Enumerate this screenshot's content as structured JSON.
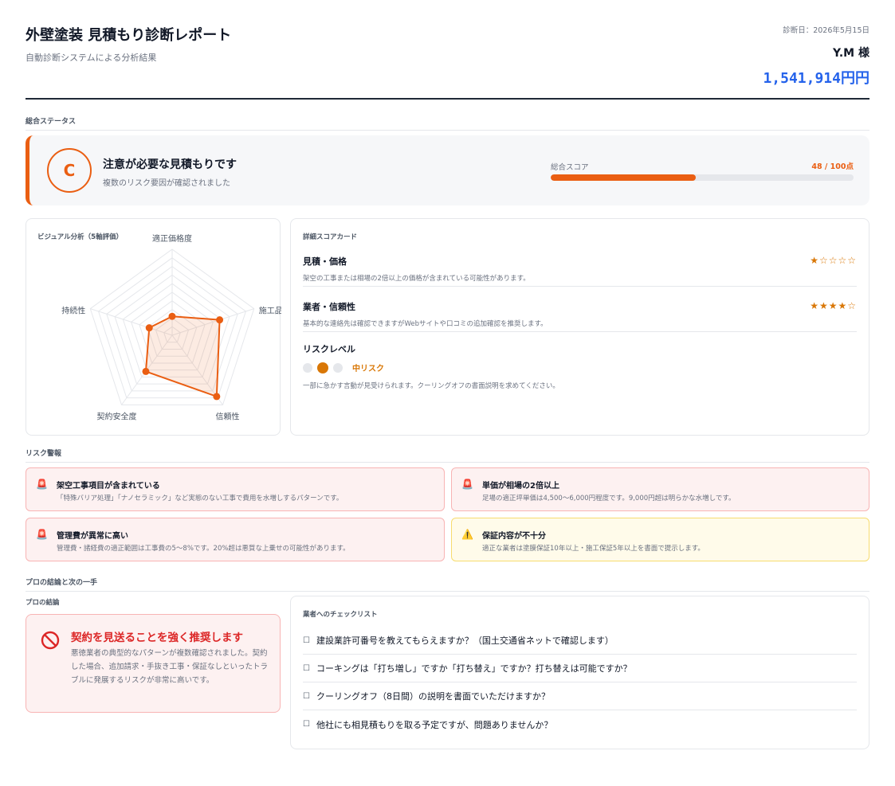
{
  "header": {
    "title": "外壁塗装 見積もり診断レポート",
    "subtitle": "自動診断システムによる分析結果",
    "date": "診断日：2026年5月15日",
    "client": "Y.M 様",
    "amount": "1,541,914円円"
  },
  "sections": {
    "status": "総合ステータス",
    "risks": "リスク警報",
    "conclusion": "プロの結論と次の一手"
  },
  "status": {
    "grade": "C",
    "title": "注意が必要な見積もりです",
    "subtitle": "複数のリスク要因が確認されました",
    "score_label": "総合スコア",
    "score_text": "48 / 100点",
    "score_percent": 48,
    "accent": "#ea5e12"
  },
  "radar": {
    "title": "ビジュアル分析（5軸評価）",
    "axes": [
      {
        "label": "適正価格度",
        "value": 0.22
      },
      {
        "label": "施工品質",
        "value": 0.58
      },
      {
        "label": "信頼性",
        "value": 0.88
      },
      {
        "label": "契約安全度",
        "value": 0.52
      },
      {
        "label": "持続性",
        "value": 0.28
      }
    ],
    "levels": 10,
    "stroke": "#ea5e12"
  },
  "score_card": {
    "title": "詳細スコアカード",
    "rows": [
      {
        "name": "見積・価格",
        "stars": "★☆☆☆☆",
        "desc": "架空の工事または相場の2倍以上の価格が含まれている可能性があります。"
      },
      {
        "name": "業者・信頼性",
        "stars": "★★★★☆",
        "desc": "基本的な連絡先は確認できますがWebサイトや口コミの追加確認を推奨します。"
      }
    ],
    "risk": {
      "name": "リスクレベル",
      "level": "中リスク",
      "desc": "一部に急かす言動が見受けられます。クーリングオフの書面説明を求めてください。"
    }
  },
  "alerts": [
    {
      "icon": "🚨",
      "title": "架空工事項目が含まれている",
      "desc": "「特殊バリア処理」「ナノセラミック」など実態のない工事で費用を水増しするパターンです。",
      "type": "danger"
    },
    {
      "icon": "🚨",
      "title": "単価が相場の2倍以上",
      "desc": "足場の適正坪単価は4,500〜6,000円程度です。9,000円超は明らかな水増しです。",
      "type": "danger"
    },
    {
      "icon": "🚨",
      "title": "管理費が異常に高い",
      "desc": "管理費・諸経費の適正範囲は工事費の5〜8%です。20%超は悪質な上乗せの可能性があります。",
      "type": "danger"
    },
    {
      "icon": "⚠️",
      "title": "保証内容が不十分",
      "desc": "適正な業者は塗膜保証10年以上・施工保証5年以上を書面で提示します。",
      "type": "warn"
    }
  ],
  "verdict": {
    "label": "プロの結論",
    "title": "契約を見送ることを強く推奨します",
    "text": "悪徳業者の典型的なパターンが複数確認されました。契約した場合、追加請求・手抜き工事・保証なしといったトラブルに発展するリスクが非常に高いです。"
  },
  "checklist": {
    "title": "業者へのチェックリスト",
    "items": [
      "建設業許可番号を教えてもらえますか？（国土交通省ネットで確認します）",
      "コーキングは「打ち増し」ですか「打ち替え」ですか？打ち替えは可能ですか？",
      "クーリングオフ（8日間）の説明を書面でいただけますか？",
      "他社にも相見積もりを取る予定ですが、問題ありませんか？"
    ]
  }
}
